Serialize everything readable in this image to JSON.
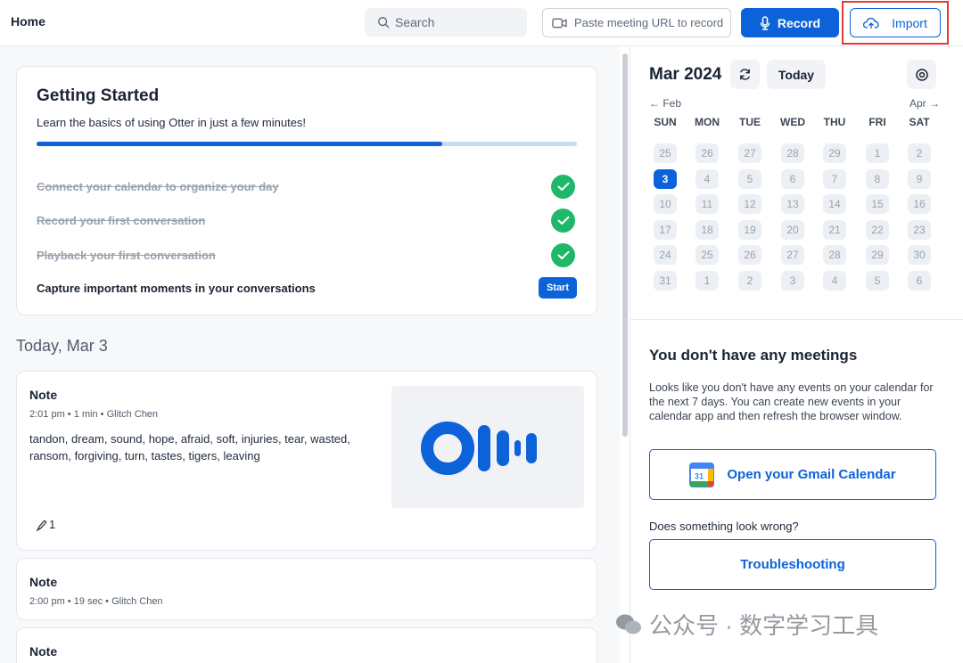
{
  "header": {
    "home": "Home",
    "search_placeholder": "Search",
    "paste_url": "Paste meeting URL to record",
    "record": "Record",
    "import": "Import"
  },
  "getting_started": {
    "title": "Getting Started",
    "subtitle": "Learn the basics of using Otter in just a few minutes!",
    "progress": 0.75,
    "tasks": [
      {
        "label": "Connect your calendar to organize your day",
        "done": true
      },
      {
        "label": "Record your first conversation",
        "done": true
      },
      {
        "label": "Playback your first conversation",
        "done": true
      },
      {
        "label": "Capture important moments in your conversations",
        "done": false
      }
    ],
    "start": "Start"
  },
  "today_heading": "Today, Mar 3",
  "notes": [
    {
      "title": "Note",
      "meta": "2:01 pm  •  1 min  •  Glitch Chen",
      "keywords": "tandon, dream, sound, hope, afraid, soft, injuries, tear, wasted, ransom, forgiving, turn, tastes, tigers, leaving",
      "count": "1"
    },
    {
      "title": "Note",
      "meta": "2:00 pm  •  19 sec  •  Glitch Chen"
    },
    {
      "title": "Note"
    }
  ],
  "calendar": {
    "title": "Mar 2024",
    "today": "Today",
    "prev": "Feb",
    "next": "Apr",
    "dows": [
      "SUN",
      "MON",
      "TUE",
      "WED",
      "THU",
      "FRI",
      "SAT"
    ],
    "weeks": [
      [
        "25",
        "26",
        "27",
        "28",
        "29",
        "1",
        "2"
      ],
      [
        "3",
        "4",
        "5",
        "6",
        "7",
        "8",
        "9"
      ],
      [
        "10",
        "11",
        "12",
        "13",
        "14",
        "15",
        "16"
      ],
      [
        "17",
        "18",
        "19",
        "20",
        "21",
        "22",
        "23"
      ],
      [
        "24",
        "25",
        "26",
        "27",
        "28",
        "29",
        "30"
      ],
      [
        "31",
        "1",
        "2",
        "3",
        "4",
        "5",
        "6"
      ]
    ],
    "selected": "3"
  },
  "meetings": {
    "heading": "You don't have any meetings",
    "body": "Looks like you don't have any events on your calendar for the next 7 days. You can create new events in your calendar app and then refresh the browser window.",
    "gmail_button": "Open your Gmail Calendar",
    "gmail_icon_text": "31",
    "wrong": "Does something look wrong?",
    "troubleshoot": "Troubleshooting"
  },
  "watermark": "公众号 · 数字学习工具",
  "colors": {
    "accent": "#0c63d9",
    "success": "#1fb86b",
    "highlight": "#e53935"
  }
}
